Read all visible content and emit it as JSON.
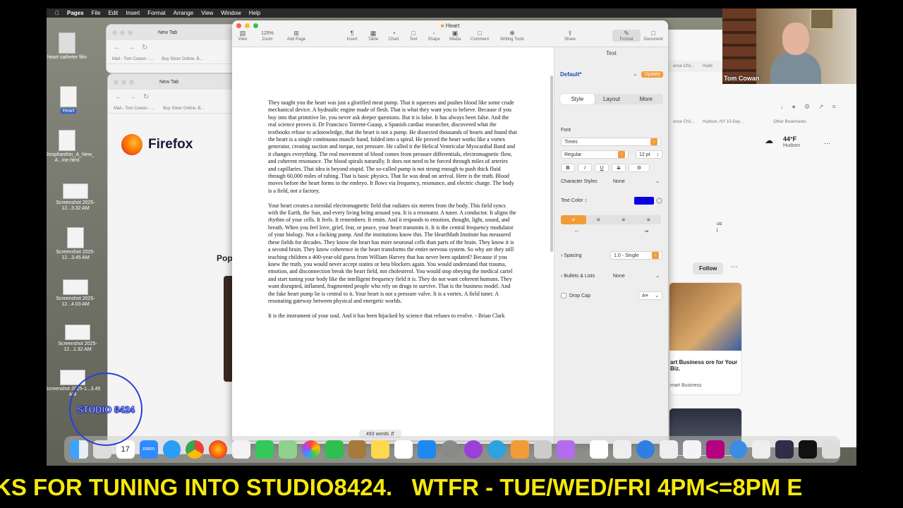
{
  "menubar": {
    "app": "Pages",
    "items": [
      "File",
      "Edit",
      "Insert",
      "Format",
      "Arrange",
      "View",
      "Window",
      "Help"
    ]
  },
  "desktop": {
    "icons": [
      {
        "label": "heart catheter film"
      },
      {
        "label": "Heart"
      },
      {
        "label": "G-Strophanthin_A_New_ A...ine.html"
      },
      {
        "label": "Screenshot 2025-12...3.32 AM"
      },
      {
        "label": "Screenshot 2025-12...3.45 AM"
      },
      {
        "label": "Screenshot 2025-12...4.03 AM"
      },
      {
        "label": "Screenshot 2025-12...1.32 AM"
      },
      {
        "label": "Screenshot 2025-1...3.45 AM"
      }
    ]
  },
  "browser_back": {
    "tab": "New Tab",
    "bookmarks": [
      "Mail - Tom Cowan - ...",
      "Buy Silver Online, B..."
    ]
  },
  "browser_front": {
    "tab": "New Tab",
    "bookmarks": [
      "Mail - Tom Cowan - ...",
      "Buy Silver Online, B..."
    ],
    "brand": "Firefox",
    "popular": "Pop"
  },
  "right_browser": {
    "bookmarks": [
      "ense Chil...",
      "Hudson, NY 10-Day ...",
      "Other Bookmarks"
    ],
    "bookmarks_top": [
      "ense Chil...",
      "Huds"
    ],
    "weather": {
      "temp": "44°F",
      "city": "Hudson"
    },
    "side_text": [
      "us",
      "l"
    ],
    "follow": "Follow",
    "card1": {
      "title": "art Business ore for Your Biz.",
      "source": "mart Business"
    }
  },
  "pages": {
    "title": "Heart",
    "zoom": "125%",
    "toolbar": [
      "View",
      "Zoom",
      "Add Page",
      "Insert",
      "Table",
      "Chart",
      "Text",
      "Shape",
      "Media",
      "Comment",
      "Writing Tools",
      "Share",
      "Format",
      "Document"
    ],
    "doc": {
      "paragraphs": [
        "They taught you the heart was just a glorified meat pump. That it squeezes and pushes blood like some crude mechanical device. A hydraulic engine made of flesh. That is what they want you to believe. Because if you buy into that primitive lie, you never ask deeper questions. But it is false. It has always been false. And the real science proves it. Dr Francisco Torrent-Guasp, a Spanish cardiac researcher, discovered what the textbooks refuse to acknowledge, that the heart is not a pump. He dissected thousands of hearts and found that the heart is a single continuous muscle band, folded into a spiral. He proved the heart works like a vortex generator, creating suction and torque, not pressure. He called it the Helical Ventricular Myocardial Band and it changes everything. The real movement of blood comes from pressure differentials, electromagnetic flow, and coherent resonance. The blood spirals naturally. It does not need to be forced through miles of arteries and capillaries. That idea is beyond stupid. The so-called pump is not strong enough to push thick fluid through 60,000 miles of tubing. That is basic physics. That lie was dead on arrival. Here is the truth. Blood moves before the heart forms in the embryo. It flows via frequency, resonance, and electric charge. The body is a field, not a factory.",
        "Your heart creates a toroidal electromagnetic field that radiates six metres from the body. This field syncs with the Earth, the Sun, and every living being around you. It is a resonator. A tuner. A conductor. It aligns the rhythm of your cells. It feels. It remembers. It emits. And it responds to emotion, thought, light, sound, and breath. When you feel love, grief, fear, or peace,  your heart transmits it. It is the central frequency modulator of your biology. Not a fucking pump. And the institutions know this. The HeartMath Institute has measured these fields for decades. They know the heart has more neuronal cells than parts of the brain. They know it is a second brain. They know coherence in the heart transforms the entire nervous system. So why are they still teaching children a 400-year-old guess from William Harvey that has never been updated? Because if you knew the truth, you would never accept statins or beta blockers again. You would understand that trauma, emotion, and disconnection break the heart field, not cholesterol. You would stop obeying the medical cartel and start tuning your body like the intelligent frequency field it is. They do not want coherent humans. They want disrupted, inflamed, fragmented people who rely on drugs to survive. That is the business model. And the fake heart pump lie is central to it. Your heart is not a pressure valve. It is a vortex. A field tuner. A resonating gateway between physical and energetic worlds.",
        "It is the instrument of your soul. And it has been hijacked by science that refuses to evolve. - Brian Clark"
      ]
    },
    "word_count": "493 words",
    "inspector": {
      "header": "Text",
      "para_style": "Default*",
      "update": "Update",
      "tabs": [
        "Style",
        "Layout",
        "More"
      ],
      "font_label": "Font",
      "font": "Times",
      "typeface": "Regular",
      "size": "12 pt",
      "char_styles_label": "Character Styles",
      "char_styles": "None",
      "text_color_label": "Text Color",
      "text_color": "#0a00e6",
      "spacing_label": "Spacing",
      "spacing": "1.0 - Single",
      "bullets_label": "Bullets & Lists",
      "bullets": "None",
      "dropcap_label": "Drop Cap"
    }
  },
  "webcam": {
    "name": "Tom Cowan"
  },
  "dock": {
    "calendar_day": "17",
    "zoom": "zoom"
  },
  "watermark": {
    "text": "STUDIO 8424"
  },
  "ticker": {
    "text": "KS FOR TUNING INTO STUDIO8424.   WTFR - TUE/WED/FRI 4PM<=8PM E"
  }
}
